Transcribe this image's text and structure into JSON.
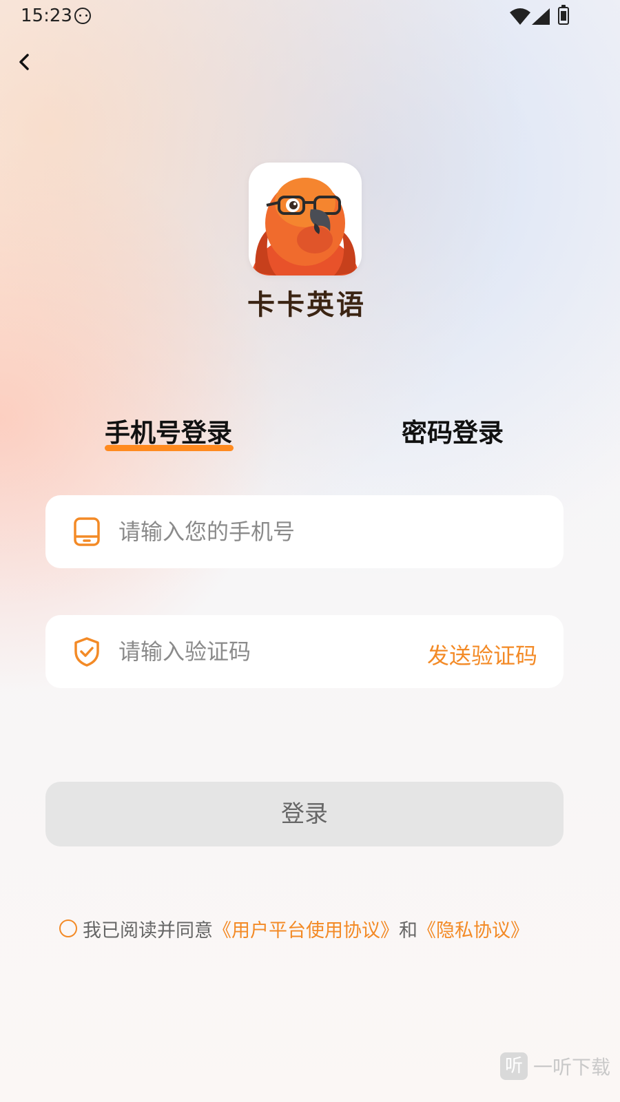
{
  "status_bar": {
    "time": "15:23"
  },
  "app": {
    "name": "卡卡英语"
  },
  "tabs": [
    {
      "label": "手机号登录",
      "active": true
    },
    {
      "label": "密码登录",
      "active": false
    }
  ],
  "phone_field": {
    "placeholder": "请输入您的手机号",
    "value": ""
  },
  "code_field": {
    "placeholder": "请输入验证码",
    "value": "",
    "send_label": "发送验证码"
  },
  "login_button": {
    "label": "登录"
  },
  "agreement": {
    "prefix": "我已阅读并同意",
    "terms_link": "《用户平台使用协议》",
    "conjunction": "和",
    "privacy_link": "《隐私协议》",
    "checked": false
  },
  "watermark": {
    "mark": "听",
    "text": "一听下载"
  },
  "colors": {
    "accent": "#ff8a1f",
    "link": "#f38a26",
    "button_disabled": "#e5e5e5"
  }
}
